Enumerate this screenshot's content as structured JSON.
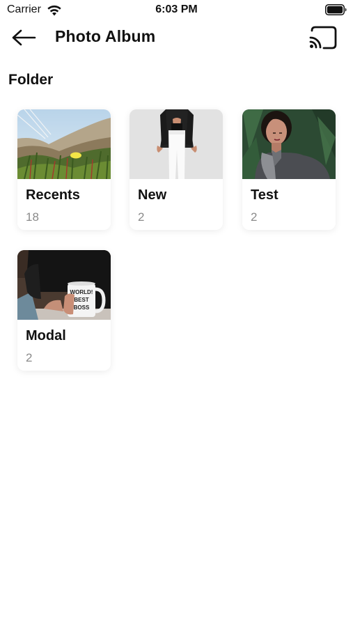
{
  "status_bar": {
    "carrier": "Carrier",
    "time": "6:03 PM",
    "wifi_icon": "wifi-icon",
    "battery_icon": "battery-icon"
  },
  "app_bar": {
    "title": "Photo Album",
    "back_icon": "arrow-left-icon",
    "cast_icon": "cast-icon"
  },
  "section": {
    "title": "Folder"
  },
  "folders": [
    {
      "name": "Recents",
      "count": "18",
      "thumbnail": "landscape-photo"
    },
    {
      "name": "New",
      "count": "2",
      "thumbnail": "fashion-photo"
    },
    {
      "name": "Test",
      "count": "2",
      "thumbnail": "portrait-photo"
    },
    {
      "name": "Modal",
      "count": "2",
      "thumbnail": "mug-photo",
      "mug_text": [
        "WORLD!",
        "BEST",
        "BOSS"
      ]
    }
  ],
  "colors": {
    "background": "#ffffff",
    "text_primary": "#111111",
    "text_secondary": "#8a8a8a"
  }
}
